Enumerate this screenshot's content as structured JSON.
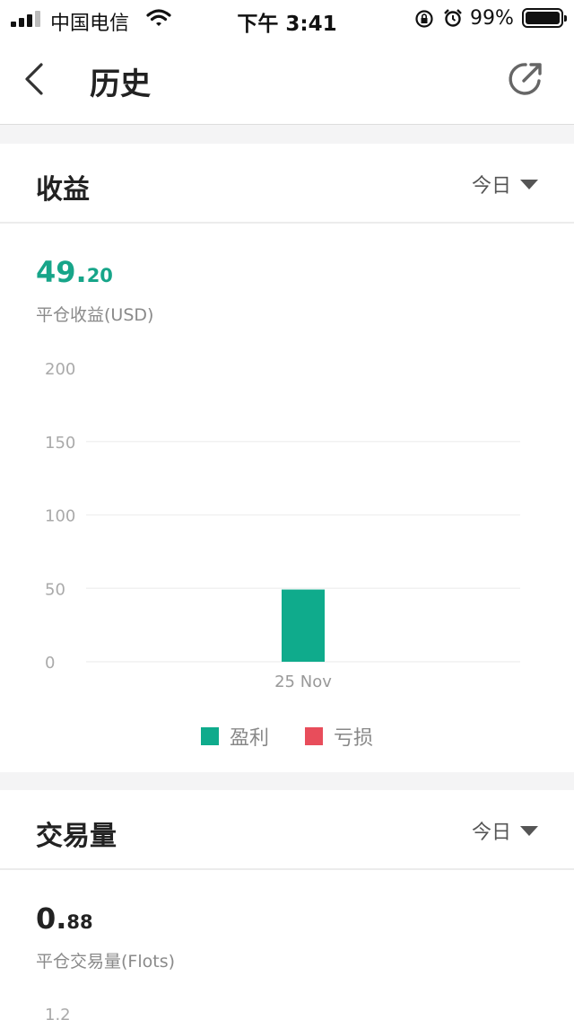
{
  "status_bar": {
    "carrier": "中国电信",
    "time": "下午 3:41",
    "battery": "99%"
  },
  "nav": {
    "title": "历史",
    "back_icon": "chevron-left-icon",
    "share_icon": "share-arrow-icon"
  },
  "profit_card": {
    "title": "收益",
    "period": "今日",
    "value_int": "49.",
    "value_dec": "20",
    "value_label": "平仓收益(USD)",
    "value_color": "#17a589",
    "chart_data": {
      "type": "bar",
      "categories": [
        "25 Nov"
      ],
      "series": [
        {
          "name": "盈利",
          "values": [
            49.2
          ],
          "color": "#0fab8c"
        },
        {
          "name": "亏损",
          "values": [
            0
          ],
          "color": "#e84d5b"
        }
      ],
      "yticks": [
        "200",
        "150",
        "100",
        "50",
        "0"
      ],
      "ylim": [
        0,
        200
      ],
      "grid": true,
      "legend": "bottom-center"
    }
  },
  "volume_card": {
    "title": "交易量",
    "period": "今日",
    "value_int": "0.",
    "value_dec": "88",
    "value_label": "平仓交易量(Flots)",
    "ytick_top": "1.2"
  }
}
